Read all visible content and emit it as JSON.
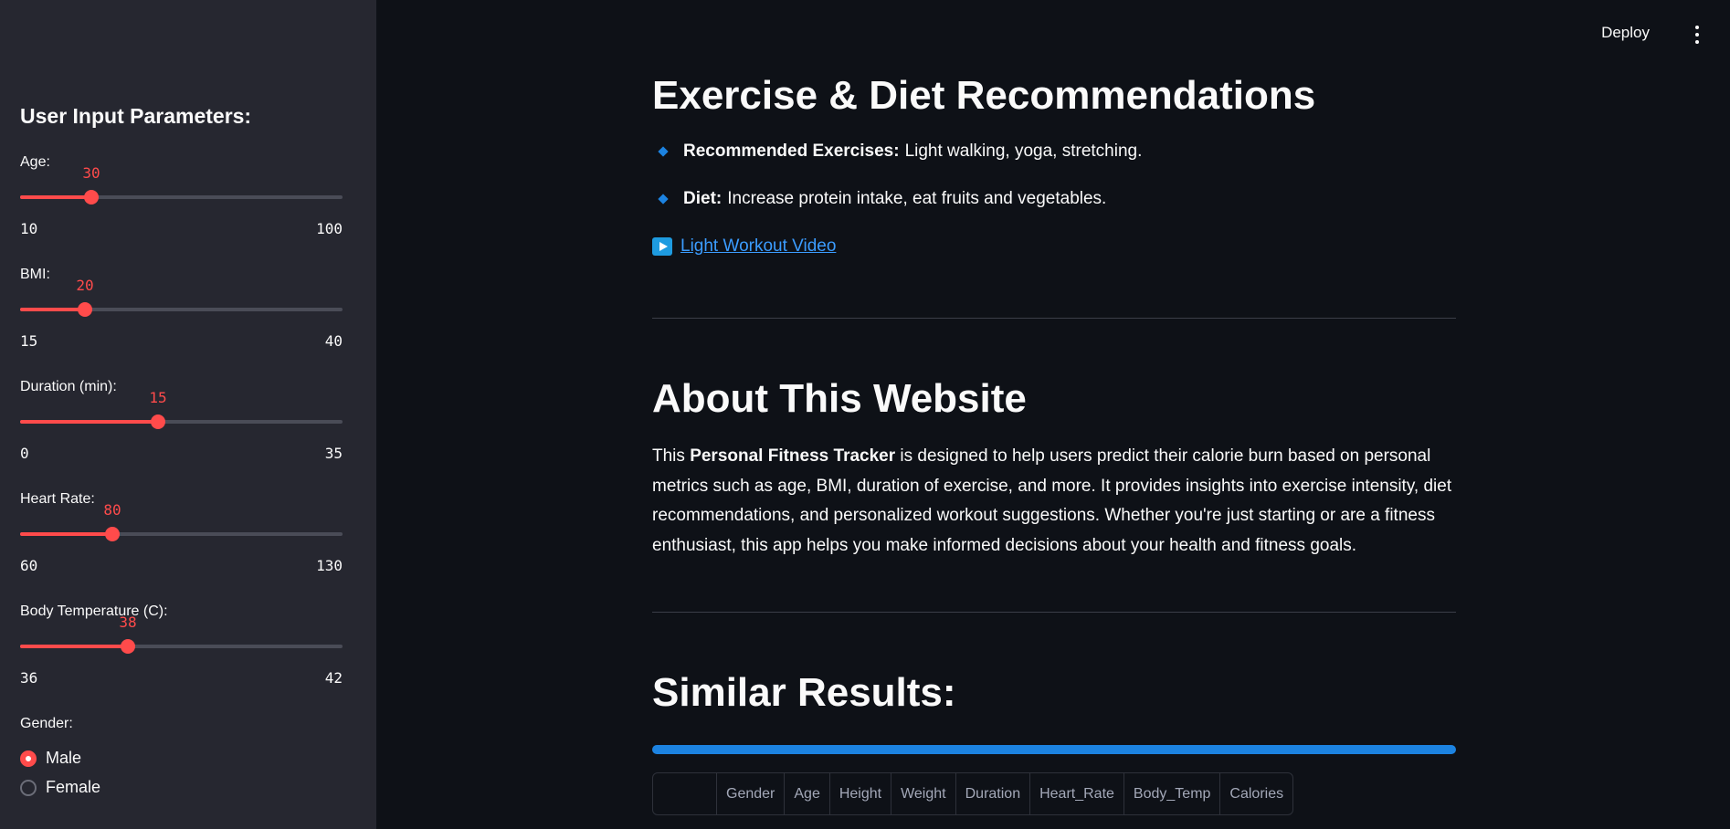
{
  "header": {
    "deploy_label": "Deploy"
  },
  "sidebar": {
    "title": "User Input Parameters:",
    "sliders": [
      {
        "label": "Age:",
        "value": "30",
        "min": "10",
        "max": "100"
      },
      {
        "label": "BMI:",
        "value": "20",
        "min": "15",
        "max": "40"
      },
      {
        "label": "Duration (min):",
        "value": "15",
        "min": "0",
        "max": "35"
      },
      {
        "label": "Heart Rate:",
        "value": "80",
        "min": "60",
        "max": "130"
      },
      {
        "label": "Body Temperature (C):",
        "value": "38",
        "min": "36",
        "max": "42"
      }
    ],
    "gender": {
      "label": "Gender:",
      "options": [
        "Male",
        "Female"
      ],
      "selected": "Male"
    }
  },
  "main": {
    "recommendations": {
      "title": "Exercise & Diet Recommendations",
      "exercises_label": "Recommended Exercises:",
      "exercises_text": "Light walking, yoga, stretching.",
      "diet_label": "Diet:",
      "diet_text": "Increase protein intake, eat fruits and vegetables.",
      "video_link": "Light Workout Video"
    },
    "about": {
      "title": "About This Website",
      "text_prefix": "This ",
      "text_bold": "Personal Fitness Tracker",
      "text_rest": " is designed to help users predict their calorie burn based on personal metrics such as age, BMI, duration of exercise, and more. It provides insights into exercise intensity, diet recommendations, and personalized workout suggestions. Whether you're just starting or are a fitness enthusiast, this app helps you make informed decisions about your health and fitness goals."
    },
    "similar": {
      "title": "Similar Results:",
      "progress": 1.0,
      "columns": [
        "",
        "Gender",
        "Age",
        "Height",
        "Weight",
        "Duration",
        "Heart_Rate",
        "Body_Temp",
        "Calories"
      ]
    }
  },
  "colors": {
    "accent": "#ff4b4b",
    "progress": "#1c83e1",
    "link": "#3b9cff",
    "sidebar_bg": "#262730",
    "main_bg": "#0e1117"
  }
}
